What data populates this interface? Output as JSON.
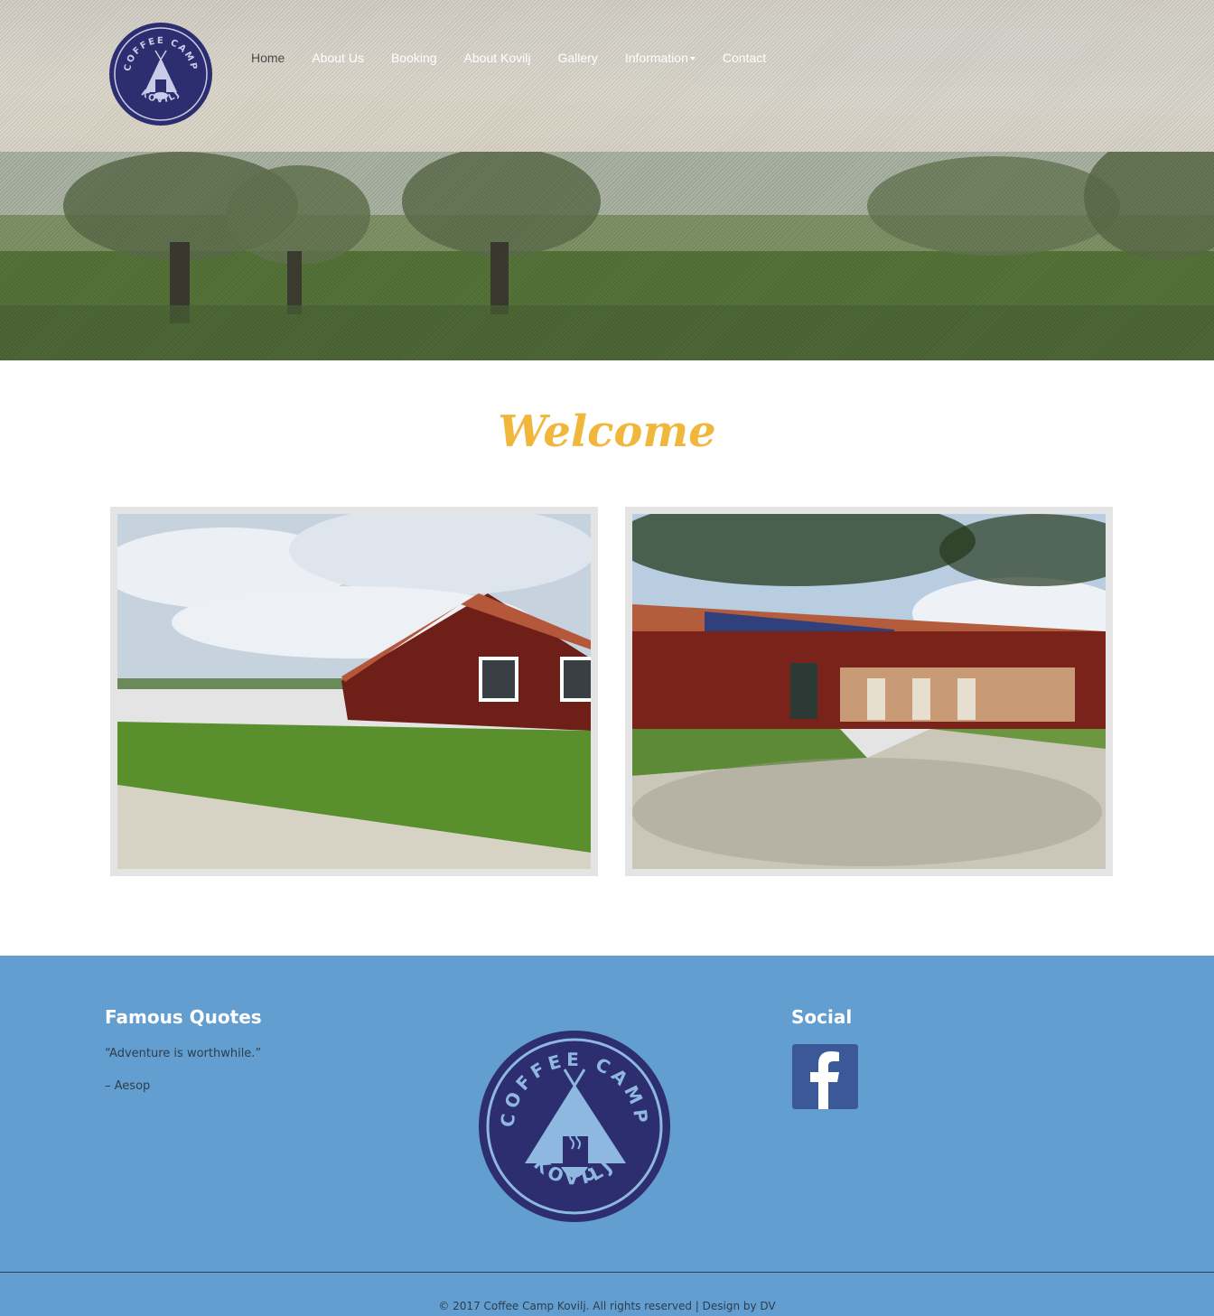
{
  "logo": {
    "ring_text_top": "COFFEE CAMP",
    "ring_text_bottom": "KOVILJ",
    "colors": {
      "navy": "#2d2e6f",
      "light": "#8fb8e0"
    }
  },
  "nav": {
    "items": [
      {
        "label": "Home",
        "active": true
      },
      {
        "label": "About Us"
      },
      {
        "label": "Booking"
      },
      {
        "label": "About Kovilj"
      },
      {
        "label": "Gallery"
      },
      {
        "label": "Information",
        "has_dropdown": true
      },
      {
        "label": "Contact"
      }
    ]
  },
  "main": {
    "heading": "Welcome",
    "heading_color": "#f0b73c"
  },
  "footer": {
    "background": "#629ecf",
    "quotes": {
      "heading": "Famous Quotes",
      "text": "“Adventure is worthwhile.”",
      "author": "– Aesop"
    },
    "social": {
      "heading": "Social",
      "facebook_icon": "facebook-icon"
    },
    "copyright": "© 2017 Coffee Camp Kovilj. All rights reserved | Design by DV"
  }
}
